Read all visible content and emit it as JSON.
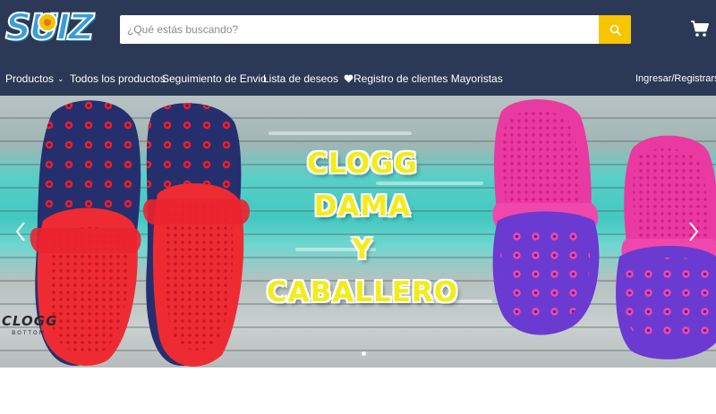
{
  "header": {
    "logo_text": "SUIZ",
    "search_placeholder": "¿Qué estás buscando?",
    "search_icon": "search-icon",
    "cart_icon": "cart-icon"
  },
  "nav": {
    "items": [
      {
        "label": "Productos",
        "icon": "chevron-down-icon"
      },
      {
        "label": "Todos los productos"
      },
      {
        "label": "Seguimiento de Envio"
      },
      {
        "label": "Lista de deseos",
        "icon": "heart-icon"
      },
      {
        "label": "Registro de clientes Mayoristas"
      }
    ],
    "account_label": "Ingresar/Registrarse"
  },
  "hero": {
    "lines": [
      "CLOGG",
      "DAMA",
      "Y",
      "CABALLERO"
    ],
    "brand_mark_top": "CLOGG",
    "brand_mark_bottom": "BOTTOM",
    "prev_icon": "chevron-left-icon",
    "next_icon": "chevron-right-icon",
    "slide_count": 1,
    "active_slide": 1
  },
  "colors": {
    "header_bg": "#2b3956",
    "search_button": "#f7c600",
    "hero_text": "#f2ec1b"
  }
}
